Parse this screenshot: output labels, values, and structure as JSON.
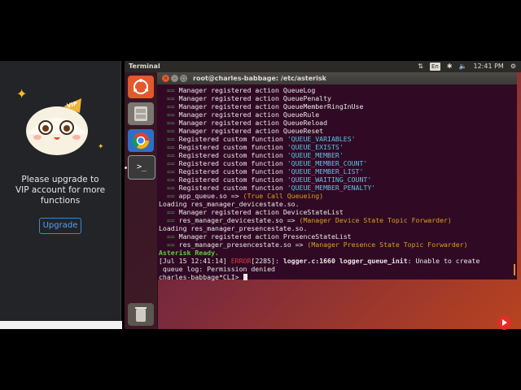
{
  "promo": {
    "badge_text": "VIP",
    "message_line1": "Please upgrade to",
    "message_line2": "VIP account for more",
    "message_line3": "functions",
    "upgrade_label": "Upgrade"
  },
  "topbar": {
    "app_title": "Terminal",
    "keyboard_layout": "En",
    "clock": "12:41 PM"
  },
  "launcher": {
    "items": [
      {
        "name": "dash",
        "icon": "ubuntu-logo-icon"
      },
      {
        "name": "files",
        "icon": "file-cabinet-icon"
      },
      {
        "name": "chromium",
        "icon": "chrome-icon"
      },
      {
        "name": "terminal",
        "icon": "terminal-icon",
        "glyph": ">_"
      },
      {
        "name": "trash",
        "icon": "trash-icon"
      }
    ]
  },
  "terminal": {
    "window_title": "root@charles-babbage: /etc/asterisk",
    "lines": [
      {
        "prefix": "  == ",
        "text": "Manager registered action QueueLog"
      },
      {
        "prefix": "  == ",
        "text": "Manager registered action QueuePenalty"
      },
      {
        "prefix": "  == ",
        "text": "Manager registered action QueueMemberRingInUse"
      },
      {
        "prefix": "  == ",
        "text": "Manager registered action QueueRule"
      },
      {
        "prefix": "  == ",
        "text": "Manager registered action QueueReload"
      },
      {
        "prefix": "  == ",
        "text": "Manager registered action QueueReset"
      },
      {
        "prefix": "  == ",
        "text": "Registered custom function ",
        "string": "'QUEUE_VARIABLES'"
      },
      {
        "prefix": "  == ",
        "text": "Registered custom function ",
        "string": "'QUEUE_EXISTS'"
      },
      {
        "prefix": "  == ",
        "text": "Registered custom function ",
        "string": "'QUEUE_MEMBER'"
      },
      {
        "prefix": "  == ",
        "text": "Registered custom function ",
        "string": "'QUEUE_MEMBER_COUNT'"
      },
      {
        "prefix": "  == ",
        "text": "Registered custom function ",
        "string": "'QUEUE_MEMBER_LIST'"
      },
      {
        "prefix": "  == ",
        "text": "Registered custom function ",
        "string": "'QUEUE_WAITING_COUNT'"
      },
      {
        "prefix": "  == ",
        "text": "Registered custom function ",
        "string": "'QUEUE_MEMBER_PENALTY'"
      },
      {
        "prefix": "  == ",
        "text": "app_queue.so => ",
        "module_desc": "(True Call Queueing)"
      },
      {
        "prefix": "",
        "text": "Loading res_manager_devicestate.so."
      },
      {
        "prefix": "  == ",
        "text": "Manager registered action DeviceStateList"
      },
      {
        "prefix": "  == ",
        "text": "res_manager_devicestate.so => ",
        "module_desc": "(Manager Device State Topic Forwarder)"
      },
      {
        "prefix": "",
        "text": "Loading res_manager_presencestate.so."
      },
      {
        "prefix": "  == ",
        "text": "Manager registered action PresenceStateList"
      },
      {
        "prefix": "  == ",
        "text": "res_manager_presencestate.so => ",
        "module_desc": "(Manager Presence State Topic Forwarder)"
      }
    ],
    "ready_text": "Asterisk Ready.",
    "error_timestamp": "[Jul 15 12:41:14] ",
    "error_label": "ERROR",
    "error_pid": "[2285]: ",
    "error_source": "logger.c:1660 logger_queue_init",
    "error_message": ": Unable to create",
    "error_continuation": " queue log: Permission denied",
    "prompt": "charles-babbage*CLI> "
  },
  "colors": {
    "terminal_bg": "#300a24",
    "string_color": "#57c7e6",
    "module_desc_color": "#d8a11a",
    "error_color": "#e23b3b",
    "ready_color": "#5ad03a"
  }
}
